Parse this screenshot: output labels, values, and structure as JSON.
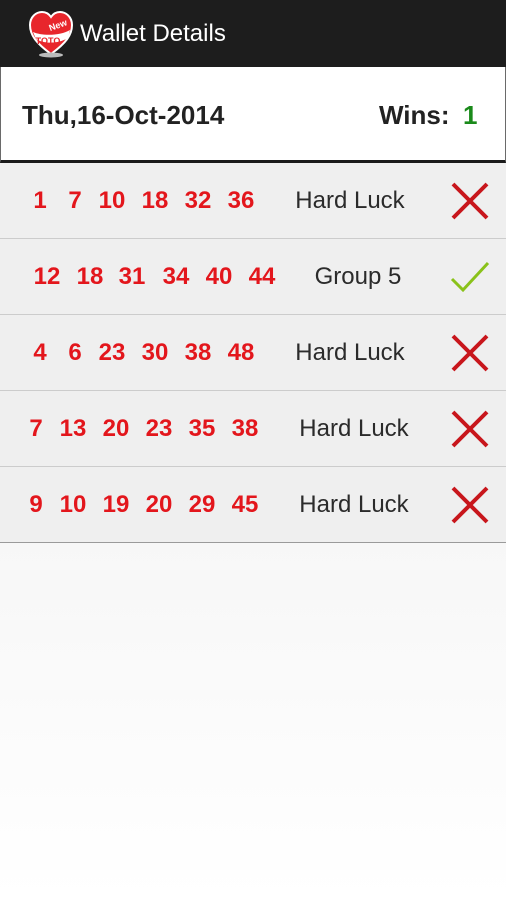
{
  "app_bar": {
    "title": "Wallet Details",
    "logo_text_top": "New",
    "logo_text_bottom": "TOTO",
    "logo_icon": "toto-heart-logo"
  },
  "header": {
    "date": "Thu,16-Oct-2014",
    "wins_label": "Wins:",
    "wins_value": "1"
  },
  "colors": {
    "number_red": "#e3161c",
    "wins_green": "#1a8a1a",
    "cross_red": "#c8161c",
    "check_green": "#8ac21a"
  },
  "tickets": [
    {
      "numbers": [
        "1",
        "7",
        "10",
        "18",
        "32",
        "36"
      ],
      "result": "Hard Luck",
      "status_icon": "cross-icon"
    },
    {
      "numbers": [
        "12",
        "18",
        "31",
        "34",
        "40",
        "44"
      ],
      "result": "Group 5",
      "status_icon": "check-icon"
    },
    {
      "numbers": [
        "4",
        "6",
        "23",
        "30",
        "38",
        "48"
      ],
      "result": "Hard Luck",
      "status_icon": "cross-icon"
    },
    {
      "numbers": [
        "7",
        "13",
        "20",
        "23",
        "35",
        "38"
      ],
      "result": "Hard Luck",
      "status_icon": "cross-icon"
    },
    {
      "numbers": [
        "9",
        "10",
        "19",
        "20",
        "29",
        "45"
      ],
      "result": "Hard Luck",
      "status_icon": "cross-icon"
    }
  ]
}
